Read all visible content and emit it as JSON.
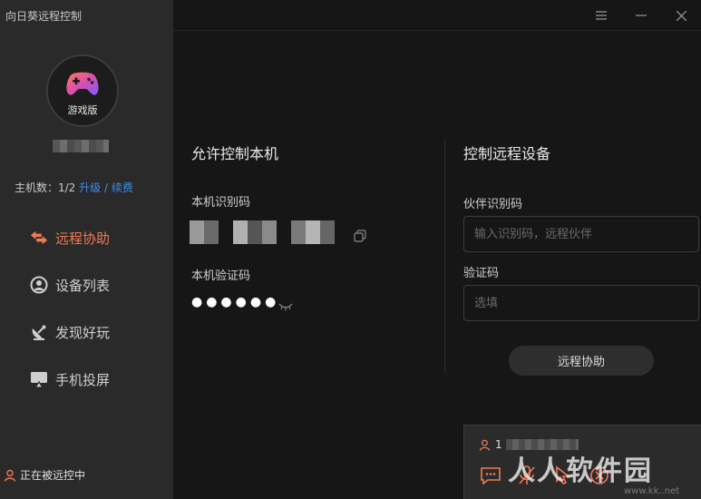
{
  "app": {
    "title": "向日葵远程控制"
  },
  "sidebar": {
    "logo_label": "游戏版",
    "host_count_label": "主机数：1/2",
    "upgrade_link": "升级",
    "separator": "/",
    "renew_link": "续费",
    "nav": [
      {
        "label": "远程协助",
        "icon": "swap-arrows-icon",
        "active": true
      },
      {
        "label": "设备列表",
        "icon": "device-list-icon",
        "active": false
      },
      {
        "label": "发现好玩",
        "icon": "satellite-dish-icon",
        "active": false
      },
      {
        "label": "手机投屏",
        "icon": "screen-cast-icon",
        "active": false
      }
    ],
    "status_text": "正在被远控中"
  },
  "allow_section": {
    "title": "允许控制本机",
    "id_label": "本机识别码",
    "code_label": "本机验证码",
    "code_masked": "●●●●●●"
  },
  "control_section": {
    "title": "控制远程设备",
    "partner_label": "伙伴识别码",
    "partner_placeholder": "输入识别码，远程伙伴",
    "code_label": "验证码",
    "code_placeholder": "选填",
    "connect_button": "远程协助"
  },
  "session_panel": {
    "user_prefix": "1"
  },
  "watermark": {
    "main": "人人软件园",
    "sub": "www.kk..net"
  },
  "colors": {
    "accent": "#f07a54",
    "link": "#3f8ee6",
    "sidebar_bg": "#2a2a2a",
    "main_bg": "#161616"
  }
}
